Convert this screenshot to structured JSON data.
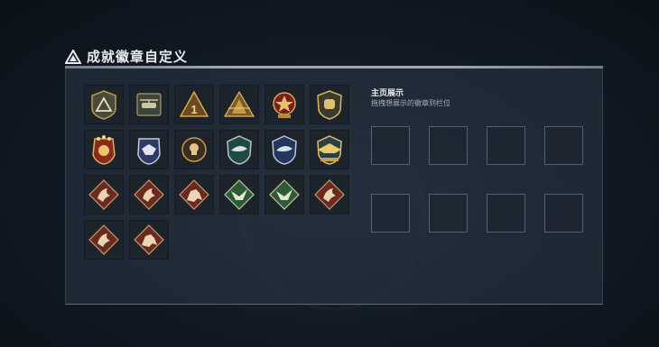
{
  "header": {
    "title": "成就徽章自定义",
    "logo_icon": "warning-triangle-icon"
  },
  "badges": [
    {
      "icon": "triangle-shield-icon"
    },
    {
      "icon": "helicopter-badge-icon"
    },
    {
      "icon": "rank-one-badge-icon"
    },
    {
      "icon": "pyramid-badge-icon"
    },
    {
      "icon": "red-cross-star-icon"
    },
    {
      "icon": "gold-fist-badge-icon"
    },
    {
      "icon": "star-crest-badge-icon"
    },
    {
      "icon": "silver-eagle-badge-icon"
    },
    {
      "icon": "skull-medal-icon"
    },
    {
      "icon": "shark-green-badge-icon"
    },
    {
      "icon": "shark-blue-badge-icon"
    },
    {
      "icon": "gold-eagle-badge-icon"
    },
    {
      "icon": "dragon-diamond-icon"
    },
    {
      "icon": "dragon-diamond-icon"
    },
    {
      "icon": "horseman-diamond-icon"
    },
    {
      "icon": "winged-beast-green-icon"
    },
    {
      "icon": "winged-beast-green-icon"
    },
    {
      "icon": "dragon-diamond-icon"
    },
    {
      "icon": "dragon-diamond-icon"
    },
    {
      "icon": "horseman-diamond-icon"
    }
  ],
  "showcase": {
    "title": "主页展示",
    "subtitle": "拖拽想展示的徽章到栏位",
    "slot_count": 8
  }
}
